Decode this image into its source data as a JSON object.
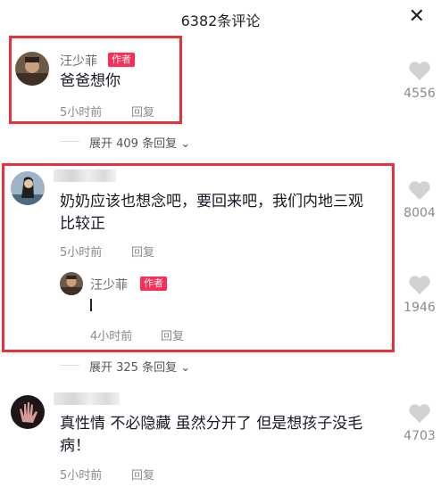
{
  "header": {
    "title": "6382条评论",
    "close_glyph": "✕"
  },
  "comments": [
    {
      "user": "汪少菲",
      "badge": "作者",
      "text": "爸爸想你",
      "time": "5小时前",
      "reply": "回复",
      "likes": "4556",
      "expand": "展开 409 条回复"
    },
    {
      "user": "",
      "text_line1": "奶奶应该也想念吧，要回来吧，我们内地三观",
      "text_line2": "比较正",
      "time": "5小时前",
      "reply": "回复",
      "likes": "8004",
      "sub_reply": {
        "user": "汪少菲",
        "badge": "作者",
        "time": "4小时前",
        "reply": "回复",
        "likes": "1946"
      },
      "expand": "展开 325 条回复"
    },
    {
      "user": "",
      "text_line1": "真性情 不必隐藏 虽然分开了 但是想孩子没毛",
      "text_line2": "病！",
      "time": "5小时前",
      "reply": "回复",
      "likes": "4703"
    }
  ],
  "colors": {
    "highlight": "#e8323a",
    "badge": "#fe2c55"
  }
}
